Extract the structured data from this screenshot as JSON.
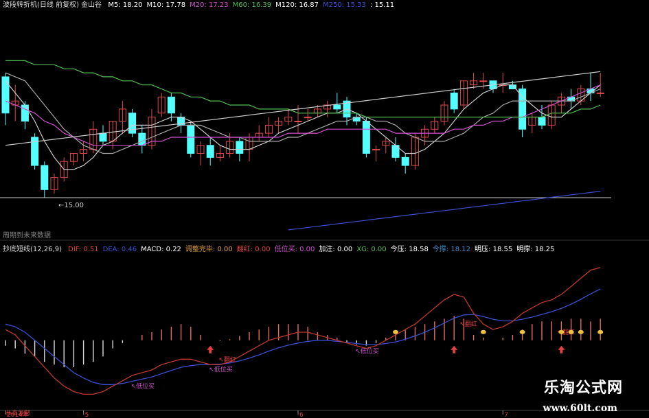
{
  "main_header": {
    "name": "波段转折机(日线 前复权) 金山谷",
    "ma": [
      {
        "label": "M5: 18.20",
        "color": "#ffffff"
      },
      {
        "label": "M10: 17.78",
        "color": "#ffffff"
      },
      {
        "label": "M20: 17.23",
        "color": "#d14fd1"
      },
      {
        "label": "M60: 16.39",
        "color": "#4fbf4f"
      },
      {
        "label": "M120: 16.87",
        "color": "#ffffff"
      },
      {
        "label": "M250: 15.33",
        "color": "#3a4fd0"
      },
      {
        "label": ": 15.11",
        "color": "#ffffff"
      }
    ]
  },
  "low_label": "15.00",
  "future_label": "周期到未来数据",
  "sub_header": {
    "name": "抄底短线(12,26,9)",
    "items": [
      {
        "label": "DIF: 0.51",
        "color": "#e04040"
      },
      {
        "label": "DEA: 0.46",
        "color": "#3a4fd0"
      },
      {
        "label": "MACD: 0.22",
        "color": "#ffffff"
      },
      {
        "label": "调整完毕: 0.00",
        "color": "#e0a040"
      },
      {
        "label": "翻红: 0.00",
        "color": "#e04040"
      },
      {
        "label": "低位买: 0.00",
        "color": "#d14fd1"
      },
      {
        "label": "加注: 0.00",
        "color": "#ffffff"
      },
      {
        "label": "XG: 0.00",
        "color": "#4fbf4f"
      },
      {
        "label": "今压: 18.58",
        "color": "#ffffff"
      },
      {
        "label": "今撑: 18.12",
        "color": "#3a8fd0"
      },
      {
        "label": "明压: 18.55",
        "color": "#ffffff"
      },
      {
        "label": "明撑: 18.25",
        "color": "#ffffff"
      }
    ]
  },
  "annotations": {
    "low_buy": "低位买",
    "turn_red": "翻红",
    "stamp": "恭喜发财"
  },
  "date_axis": [
    "2014年",
    "5",
    "6",
    "7"
  ],
  "watermark": {
    "name": "乐淘公式网",
    "url": "www.60lt.com"
  },
  "chart_data": [
    {
      "type": "candlestick",
      "ylim": [
        14.2,
        19.6
      ],
      "ohlc": [
        [
          18.0,
          18.1,
          16.8,
          17.1
        ],
        [
          17.3,
          17.8,
          16.9,
          17.4
        ],
        [
          17.3,
          17.4,
          16.7,
          16.9
        ],
        [
          16.5,
          16.6,
          15.7,
          15.8
        ],
        [
          15.8,
          15.9,
          15.0,
          15.2
        ],
        [
          15.2,
          15.6,
          15.1,
          15.5
        ],
        [
          15.5,
          16.0,
          15.4,
          15.9
        ],
        [
          15.9,
          16.1,
          15.8,
          16.1
        ],
        [
          16.1,
          16.4,
          15.9,
          16.2
        ],
        [
          16.2,
          16.9,
          16.1,
          16.7
        ],
        [
          16.6,
          16.8,
          16.3,
          16.4
        ],
        [
          16.4,
          16.9,
          16.2,
          16.9
        ],
        [
          16.9,
          17.4,
          16.6,
          17.2
        ],
        [
          17.1,
          17.2,
          16.5,
          16.6
        ],
        [
          16.6,
          16.8,
          16.1,
          16.3
        ],
        [
          16.3,
          17.2,
          16.2,
          17.0
        ],
        [
          17.1,
          17.6,
          17.0,
          17.5
        ],
        [
          17.5,
          17.6,
          16.9,
          17.1
        ],
        [
          17.0,
          17.1,
          16.6,
          16.8
        ],
        [
          16.8,
          16.9,
          16.0,
          16.1
        ],
        [
          16.1,
          16.4,
          15.8,
          16.3
        ],
        [
          16.3,
          16.5,
          15.8,
          16.0
        ],
        [
          16.0,
          16.3,
          15.9,
          16.1
        ],
        [
          16.1,
          16.6,
          16.0,
          16.4
        ],
        [
          16.4,
          16.5,
          15.9,
          16.1
        ],
        [
          16.2,
          16.6,
          15.9,
          16.5
        ],
        [
          16.5,
          16.8,
          16.4,
          16.6
        ],
        [
          16.6,
          17.0,
          16.5,
          16.8
        ],
        [
          16.8,
          17.0,
          16.6,
          16.9
        ],
        [
          16.9,
          17.2,
          16.8,
          17.0
        ],
        [
          16.9,
          17.3,
          16.6,
          16.9
        ],
        [
          17.0,
          17.2,
          16.9,
          17.0
        ],
        [
          17.1,
          17.3,
          17.0,
          17.2
        ],
        [
          17.2,
          17.4,
          17.0,
          17.3
        ],
        [
          17.3,
          17.6,
          17.1,
          17.2
        ],
        [
          17.4,
          17.5,
          16.8,
          17.0
        ],
        [
          17.0,
          17.1,
          16.8,
          16.9
        ],
        [
          16.9,
          17.0,
          16.0,
          16.1
        ],
        [
          16.2,
          16.3,
          15.9,
          16.2
        ],
        [
          16.3,
          16.5,
          16.1,
          16.4
        ],
        [
          16.3,
          16.5,
          15.9,
          16.0
        ],
        [
          16.0,
          16.1,
          15.6,
          15.8
        ],
        [
          15.8,
          16.6,
          15.7,
          16.5
        ],
        [
          16.5,
          16.8,
          16.3,
          16.7
        ],
        [
          16.7,
          17.0,
          16.6,
          16.9
        ],
        [
          16.9,
          17.4,
          16.8,
          17.3
        ],
        [
          17.6,
          17.7,
          17.1,
          17.2
        ],
        [
          17.3,
          17.9,
          17.2,
          17.9
        ],
        [
          17.8,
          18.1,
          17.7,
          17.9
        ],
        [
          17.9,
          18.1,
          17.7,
          17.9
        ],
        [
          17.9,
          17.9,
          17.6,
          17.7
        ],
        [
          17.8,
          18.1,
          17.6,
          17.8
        ],
        [
          17.8,
          17.9,
          17.7,
          17.7
        ],
        [
          17.7,
          17.8,
          16.5,
          16.7
        ],
        [
          16.8,
          17.1,
          16.6,
          17.0
        ],
        [
          17.0,
          17.3,
          16.7,
          16.8
        ],
        [
          16.8,
          17.4,
          16.7,
          17.3
        ],
        [
          17.3,
          17.6,
          17.1,
          17.5
        ],
        [
          17.5,
          17.7,
          17.2,
          17.4
        ],
        [
          17.4,
          17.8,
          17.3,
          17.7
        ],
        [
          17.7,
          18.1,
          17.4,
          17.6
        ],
        [
          17.6,
          18.1,
          17.5,
          17.6
        ]
      ],
      "overlays": [
        {
          "name": "M5",
          "color": "#cccccc",
          "values": [
            17.9,
            17.6,
            17.3,
            16.9,
            16.4,
            16.0,
            15.7,
            15.7,
            15.8,
            16.0,
            16.3,
            16.4,
            16.6,
            16.8,
            16.8,
            16.8,
            16.9,
            17.0,
            17.0,
            16.9,
            16.7,
            16.5,
            16.3,
            16.2,
            16.2,
            16.2,
            16.3,
            16.4,
            16.6,
            16.7,
            16.8,
            16.9,
            17.0,
            17.1,
            17.1,
            17.2,
            17.1,
            16.9,
            16.7,
            16.5,
            16.3,
            16.1,
            16.1,
            16.2,
            16.4,
            16.6,
            16.9,
            17.2,
            17.4,
            17.6,
            17.7,
            17.8,
            17.8,
            17.5,
            17.3,
            17.1,
            17.0,
            17.0,
            17.2,
            17.4,
            17.6,
            17.8
          ]
        },
        {
          "name": "M10",
          "color": "#aaaaaa",
          "values": [
            18.1,
            18.0,
            17.9,
            17.6,
            17.3,
            17.0,
            16.7,
            16.5,
            16.3,
            16.2,
            16.1,
            16.1,
            16.2,
            16.3,
            16.4,
            16.5,
            16.6,
            16.7,
            16.8,
            16.8,
            16.8,
            16.7,
            16.6,
            16.5,
            16.5,
            16.4,
            16.4,
            16.4,
            16.4,
            16.5,
            16.5,
            16.6,
            16.7,
            16.8,
            16.9,
            16.9,
            17.0,
            17.0,
            16.9,
            16.9,
            16.8,
            16.6,
            16.5,
            16.4,
            16.4,
            16.4,
            16.5,
            16.6,
            16.8,
            17.0,
            17.1,
            17.3,
            17.4,
            17.4,
            17.4,
            17.4,
            17.4,
            17.4,
            17.4,
            17.5,
            17.6,
            17.7
          ]
        },
        {
          "name": "M20",
          "color": "#d14fd1",
          "values": [
            17.4,
            17.3,
            17.2,
            17.1,
            16.9,
            16.8,
            16.6,
            16.5,
            16.4,
            16.3,
            16.3,
            16.3,
            16.3,
            16.3,
            16.3,
            16.4,
            16.4,
            16.5,
            16.5,
            16.5,
            16.5,
            16.5,
            16.5,
            16.5,
            16.5,
            16.5,
            16.5,
            16.5,
            16.5,
            16.6,
            16.6,
            16.6,
            16.6,
            16.7,
            16.7,
            16.7,
            16.7,
            16.7,
            16.7,
            16.7,
            16.6,
            16.6,
            16.6,
            16.6,
            16.6,
            16.6,
            16.7,
            16.7,
            16.8,
            16.8,
            16.9,
            16.9,
            17.0,
            17.0,
            17.1,
            17.2,
            17.3,
            17.4,
            17.5,
            17.6,
            17.7,
            17.8
          ]
        },
        {
          "name": "M60",
          "color": "#4fbf4f",
          "values": [
            18.4,
            18.4,
            18.4,
            18.3,
            18.3,
            18.3,
            18.2,
            18.2,
            18.1,
            18.1,
            18.0,
            18.0,
            17.9,
            17.9,
            17.8,
            17.8,
            17.7,
            17.6,
            17.6,
            17.5,
            17.5,
            17.4,
            17.4,
            17.3,
            17.3,
            17.3,
            17.2,
            17.2,
            17.2,
            17.2,
            17.1,
            17.1,
            17.1,
            17.1,
            17.1,
            17.1,
            17.1,
            17.0,
            17.0,
            17.0,
            17.0,
            17.0,
            17.0,
            17.0,
            17.0,
            17.0,
            17.0,
            17.0,
            17.0,
            17.0,
            17.0,
            17.0,
            17.0,
            17.0,
            17.0,
            17.0,
            17.1,
            17.1,
            17.1,
            17.2,
            17.2,
            17.3
          ]
        },
        {
          "name": "M120",
          "color": "#cccccc",
          "values": [
            16.3,
            16.33,
            16.36,
            16.39,
            16.42,
            16.45,
            16.48,
            16.51,
            16.54,
            16.57,
            16.6,
            16.63,
            16.66,
            16.69,
            16.72,
            16.75,
            16.78,
            16.81,
            16.84,
            16.87,
            16.9,
            16.93,
            16.96,
            16.99,
            17.02,
            17.05,
            17.08,
            17.11,
            17.14,
            17.17,
            17.2,
            17.23,
            17.26,
            17.29,
            17.32,
            17.35,
            17.38,
            17.41,
            17.44,
            17.47,
            17.5,
            17.53,
            17.56,
            17.59,
            17.62,
            17.65,
            17.68,
            17.71,
            17.74,
            17.77,
            17.8,
            17.83,
            17.86,
            17.89,
            17.92,
            17.95,
            17.98,
            18.01,
            18.04,
            18.07,
            18.1,
            18.13
          ]
        },
        {
          "name": "M250",
          "color": "#3a4fd0",
          "values": [
            null,
            null,
            null,
            null,
            null,
            null,
            null,
            null,
            null,
            null,
            null,
            null,
            null,
            null,
            null,
            null,
            null,
            null,
            null,
            null,
            null,
            null,
            null,
            null,
            null,
            null,
            null,
            null,
            null,
            14.2,
            14.23,
            14.26,
            14.29,
            14.32,
            14.35,
            14.38,
            14.41,
            14.44,
            14.47,
            14.5,
            14.53,
            14.56,
            14.59,
            14.62,
            14.65,
            14.68,
            14.71,
            14.74,
            14.77,
            14.8,
            14.83,
            14.86,
            14.89,
            14.92,
            14.95,
            14.98,
            15.01,
            15.04,
            15.07,
            15.1,
            15.13,
            15.16
          ]
        }
      ],
      "hline": 15.0
    },
    {
      "type": "line+bar",
      "ylim": [
        -1.3,
        1.6
      ],
      "dif": [
        0.2,
        0.1,
        -0.1,
        -0.3,
        -0.5,
        -0.7,
        -0.85,
        -0.95,
        -1.0,
        -1.0,
        -0.95,
        -0.85,
        -0.75,
        -0.65,
        -0.6,
        -0.55,
        -0.45,
        -0.4,
        -0.35,
        -0.35,
        -0.4,
        -0.45,
        -0.45,
        -0.4,
        -0.3,
        -0.2,
        -0.1,
        0.0,
        0.05,
        0.1,
        0.15,
        0.15,
        0.1,
        0.05,
        0.0,
        -0.05,
        -0.1,
        -0.15,
        -0.1,
        0.0,
        0.1,
        0.2,
        0.3,
        0.45,
        0.6,
        0.75,
        0.85,
        0.8,
        0.5,
        0.3,
        0.2,
        0.25,
        0.35,
        0.5,
        0.6,
        0.7,
        0.75,
        0.85,
        1.0,
        1.15,
        1.3,
        1.35
      ],
      "dea": [
        0.3,
        0.25,
        0.15,
        0.0,
        -0.15,
        -0.3,
        -0.45,
        -0.6,
        -0.7,
        -0.78,
        -0.82,
        -0.82,
        -0.8,
        -0.76,
        -0.72,
        -0.68,
        -0.62,
        -0.56,
        -0.5,
        -0.47,
        -0.45,
        -0.45,
        -0.44,
        -0.42,
        -0.38,
        -0.33,
        -0.27,
        -0.2,
        -0.14,
        -0.09,
        -0.05,
        -0.02,
        0.0,
        0.0,
        -0.02,
        -0.04,
        -0.06,
        -0.08,
        -0.08,
        -0.06,
        -0.03,
        0.02,
        0.08,
        0.15,
        0.23,
        0.32,
        0.41,
        0.47,
        0.48,
        0.44,
        0.39,
        0.36,
        0.36,
        0.39,
        0.43,
        0.48,
        0.53,
        0.59,
        0.67,
        0.76,
        0.86,
        0.95
      ],
      "macd": [
        -0.1,
        -0.15,
        -0.25,
        -0.3,
        -0.4,
        -0.45,
        -0.5,
        -0.5,
        -0.45,
        -0.4,
        -0.3,
        -0.15,
        -0.05,
        0.0,
        0.1,
        0.15,
        0.2,
        0.25,
        0.3,
        0.25,
        0.1,
        0.0,
        -0.01,
        0.02,
        0.08,
        0.15,
        0.2,
        0.25,
        0.3,
        0.3,
        0.3,
        0.25,
        0.15,
        0.1,
        0.05,
        -0.05,
        -0.08,
        -0.1,
        -0.05,
        0.05,
        0.15,
        0.2,
        0.25,
        0.3,
        0.35,
        0.4,
        0.45,
        0.4,
        0.1,
        0.05,
        0.0,
        0.05,
        0.1,
        0.2,
        0.3,
        0.35,
        0.35,
        0.35,
        0.4,
        0.4,
        0.35,
        0.4
      ]
    }
  ]
}
